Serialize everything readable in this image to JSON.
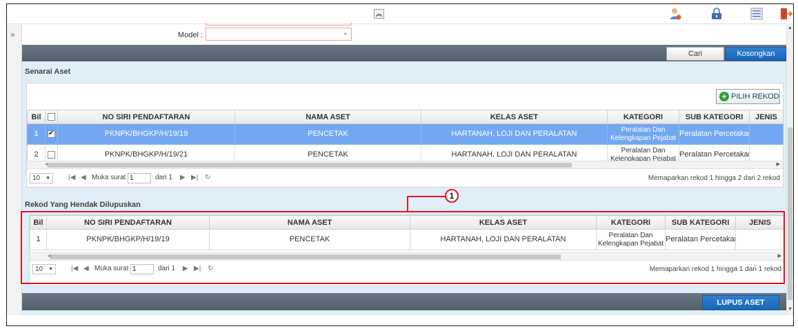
{
  "topbar": {
    "icons": [
      "user-profile-icon",
      "lock-icon",
      "list-icon",
      "logout-icon"
    ]
  },
  "filter": {
    "model_label": "Model :",
    "model_value": ""
  },
  "buttons": {
    "cari": "Cari",
    "kosongkan": "Kosongkan",
    "pilih_rekod": "PILIH REKOD",
    "lupus_aset": "LUPUS ASET"
  },
  "senarai": {
    "title": "Senarai Aset",
    "columns": [
      "Bil",
      "",
      "NO SIRI PENDAFTARAN",
      "NAMA ASET",
      "KELAS ASET",
      "KATEGORI",
      "SUB KATEGORI",
      "JENIS"
    ],
    "rows": [
      {
        "bil": "1",
        "checked": true,
        "no_siri": "PKNPK/BHGKP/H/19/19",
        "nama": "PENCETAK",
        "kelas": "HARTANAH, LOJI DAN PERALATAN",
        "kategori": "Peralatan Dan Kelengkapan Pejabat",
        "sub": "Peralatan Percetakan",
        "jenis": ""
      },
      {
        "bil": "2",
        "checked": false,
        "no_siri": "PKNPK/BHGKP/H/19/21",
        "nama": "PENCETAK",
        "kelas": "HARTANAH, LOJI DAN PERALATAN",
        "kategori": "Peralatan Dan Kelengkapan Pejabat",
        "sub": "Peralatan Percetakan",
        "jenis": ""
      }
    ],
    "pager": {
      "size": "10",
      "page_label": "Muka surat",
      "page": "1",
      "of_label": "dari 1",
      "info": "Memaparkan rekod 1 hingga 2 dari 2 rekod"
    }
  },
  "rekod": {
    "title": "Rekod Yang Hendak Dilupuskan",
    "columns": [
      "Bil",
      "NO SIRI PENDAFTARAN",
      "NAMA ASET",
      "KELAS ASET",
      "KATEGORI",
      "SUB KATEGORI",
      "JENIS"
    ],
    "rows": [
      {
        "bil": "1",
        "no_siri": "PKNPK/BHGKP/H/19/19",
        "nama": "PENCETAK",
        "kelas": "HARTANAH, LOJI DAN PERALATAN",
        "kategori": "Peralatan Dan Kelengkapan Pejabat",
        "sub": "Peralatan Percetakan",
        "jenis": ""
      }
    ],
    "pager": {
      "size": "10",
      "page_label": "Muka surat",
      "page": "1",
      "of_label": "dari 1",
      "info": "Memaparkan rekod 1 hingga 1 dari 1 rekod"
    }
  },
  "annotation": {
    "marker": "1",
    "color": "#e0161e"
  },
  "colors": {
    "selected_row": "#73a8f0",
    "primary_button": "#1766b8",
    "band": "#5e6976"
  }
}
